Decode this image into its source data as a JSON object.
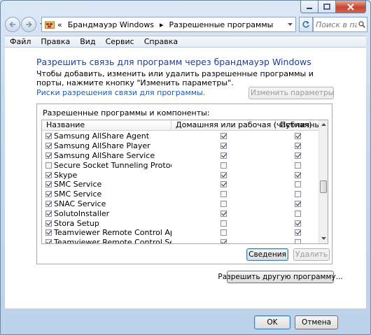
{
  "address": {
    "crumb_prefix": "«",
    "crumb1": "Брандмауэр Windows",
    "separator": "▸",
    "crumb2": "Разрешенные программы"
  },
  "search": {
    "placeholder": "Поиск в пане..."
  },
  "menu": [
    "Файл",
    "Правка",
    "Вид",
    "Сервис",
    "Справка"
  ],
  "main": {
    "title": "Разрешить связь для программ через брандмауэр Windows",
    "description": "Чтобы добавить, изменить или удалить разрешенные программы и порты, нажмите кнопку \"Изменить параметры\".",
    "risk_link": "Риски разрешения связи для программы.",
    "change_settings_button": "Изменить параметры",
    "group_label": "Разрешенные программы и компоненты:",
    "columns": {
      "name": "Название",
      "home": "Домашняя или рабочая (частная)",
      "public": "Публичные"
    },
    "programs": [
      {
        "name": "Samsung AllShare Agent",
        "enabled": true,
        "home": true,
        "public": true
      },
      {
        "name": "Samsung AllShare Player",
        "enabled": true,
        "home": true,
        "public": true
      },
      {
        "name": "Samsung AllShare Service",
        "enabled": true,
        "home": true,
        "public": true
      },
      {
        "name": "Secure Socket Tunneling Protocol",
        "enabled": false,
        "home": false,
        "public": false
      },
      {
        "name": "Skype",
        "enabled": true,
        "home": true,
        "public": true
      },
      {
        "name": "SMC Service",
        "enabled": true,
        "home": true,
        "public": false
      },
      {
        "name": "SMC Service",
        "enabled": true,
        "home": false,
        "public": false
      },
      {
        "name": "SNAC Service",
        "enabled": true,
        "home": false,
        "public": true
      },
      {
        "name": "SolutoInstaller",
        "enabled": true,
        "home": true,
        "public": false
      },
      {
        "name": "Stora Setup",
        "enabled": true,
        "home": false,
        "public": true
      },
      {
        "name": "Teamviewer Remote Control Application",
        "enabled": true,
        "home": false,
        "public": true
      },
      {
        "name": "Teamviewer Remote Control Service",
        "enabled": true,
        "home": true,
        "public": false
      }
    ],
    "details_button": "Сведения",
    "remove_button": "Удалить",
    "allow_other_button": "Разрешить другую программу..."
  },
  "footer": {
    "ok_button": "OK",
    "cancel_button": "Отмена"
  },
  "icons": {
    "back": "back-arrow-icon",
    "forward": "forward-arrow-icon",
    "refresh": "refresh-icon",
    "search": "search-icon",
    "shield": "uac-shield-icon",
    "folder": "firewall-folder-icon"
  }
}
